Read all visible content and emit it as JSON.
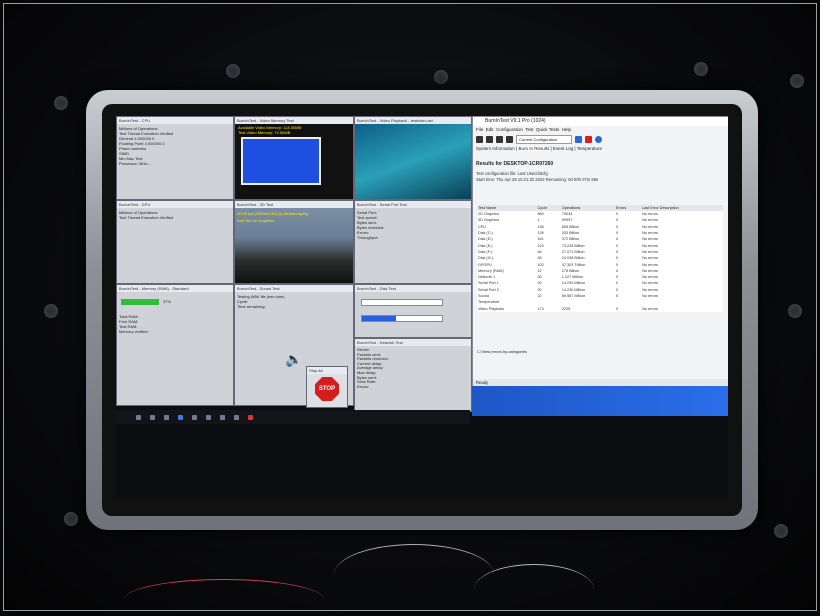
{
  "windows": {
    "cpu": {
      "title": "BurnInTest - CPU",
      "lines": [
        "Millions of Operations",
        "Test   Thread   Execution   Verified",
        "General   4   000000.0",
        "Floating Point   4   000000.0",
        "Prime numbers",
        "SIMD",
        "Min Max Test",
        "Processor, MHz:..."
      ]
    },
    "video_memory": {
      "title": "BurnInTest - Video Memory Test",
      "line1": "Available Video Memory: 114.00MB",
      "line2": "Test Video Memory: 72.50MB"
    },
    "video_playback": {
      "title": "BurnInTest - Video Playback - testvideo.avi"
    },
    "gpu": {
      "title": "BurnInTest - GPU",
      "lines": [
        "Millions of Operations",
        "Test   Thread   Execution   Verified"
      ]
    },
    "three_d": {
      "title": "BurnInTest - 3D Test",
      "line1": "40.00 fps (2560x1440) (s) Multisampling",
      "line2": "Intel Iris Xe Graphics"
    },
    "serial": {
      "title": "BurnInTest - Serial Port Test",
      "lines": [
        "Serial Port:",
        "Test speed:",
        "Bytes sent:",
        "Bytes received:",
        "Errors:",
        "Throughput:"
      ]
    },
    "memory": {
      "title": "BurnInTest - Memory (RAM) - Standard",
      "lines": [
        "Total RAM:",
        "Free RAM:",
        "Test RAM:",
        "Memory verified:"
      ],
      "percent": "37%"
    },
    "sound": {
      "title": "BurnInTest - Sound Test",
      "lines": [
        "Testing WAV file (two tone)",
        "Cycle:",
        "Time remaining:"
      ]
    },
    "disk": {
      "title": "BurnInTest - Disk Test"
    },
    "network": {
      "title": "BurnInTest - Network Test",
      "lines": [
        "Server:",
        "Packets sent:",
        "Packets received:",
        "Current delay:",
        "Average delay:",
        "Max delay:",
        "Bytes sent:",
        "Slow Rate:",
        "Errors:"
      ]
    },
    "stop": {
      "label": "STOP",
      "title": "Stop All"
    }
  },
  "main": {
    "title": "BurnInTest V9.1 Pro (1024)",
    "menu": [
      "File",
      "Edit",
      "Configuration",
      "Test",
      "Quick Tests",
      "Help"
    ],
    "config_select": "Current Configuration",
    "tabs": [
      "System Information",
      "Burn In Results",
      "Event Log",
      "Temperature"
    ],
    "results_header": "Results for DESKTOP-1CR97260",
    "info_lines": [
      "Test configuration file:   Last Used.bitcfg",
      "Start time:      Thu Apr 28 10:21:32 2022       Remaining:  0d 00h 07m 59s"
    ],
    "columns": [
      "Test Name",
      "Cycle",
      "Operations",
      "Errors",
      "Last Error Description"
    ],
    "rows": [
      [
        "2D Graphics",
        "869",
        "79034",
        "0",
        "No errors"
      ],
      [
        "3D Graphics",
        "1",
        "90997",
        "0",
        "No errors"
      ],
      [
        "CPU",
        "196",
        "655 Billion",
        "0",
        "No errors"
      ],
      [
        "Disk (C:)",
        "139",
        "333 Billion",
        "0",
        "No errors"
      ],
      [
        "Disk (D:)",
        "161",
        "372 Billion",
        "0",
        "No errors"
      ],
      [
        "Disk (E:)",
        "120",
        "73.228 Billion",
        "0",
        "No errors"
      ],
      [
        "Disk (F:)",
        "64",
        "27.071 Billion",
        "0",
        "No errors"
      ],
      [
        "Disk (G:)",
        "45",
        "24.038 Billion",
        "0",
        "No errors"
      ],
      [
        "GPGPU",
        "102",
        "47.303 Trillion",
        "0",
        "No errors"
      ],
      [
        "Memory (RAM)",
        "12",
        "276 Billion",
        "0",
        "No errors"
      ],
      [
        "Network 1",
        "30",
        "1.227 Million",
        "0",
        "No errors"
      ],
      [
        "Serial Port 1",
        "20",
        "14.230 Million",
        "0",
        "No errors"
      ],
      [
        "Serial Port 2",
        "20",
        "14.230 Million",
        "0",
        "No errors"
      ],
      [
        "Sound",
        "22",
        "59.987 Million",
        "0",
        "No errors"
      ],
      [
        "Temperature",
        "",
        "",
        "",
        ""
      ],
      [
        "Video Playback",
        "174",
        "2225",
        "0",
        "No errors"
      ]
    ],
    "checkbox_label": "View errors by categories",
    "status": "Ready"
  },
  "colors": {
    "screen_blue": "#1f4fe0",
    "progress_green": "#2fbf3a",
    "stop_red": "#d61d1d",
    "bezel": "#a3a7ac"
  }
}
